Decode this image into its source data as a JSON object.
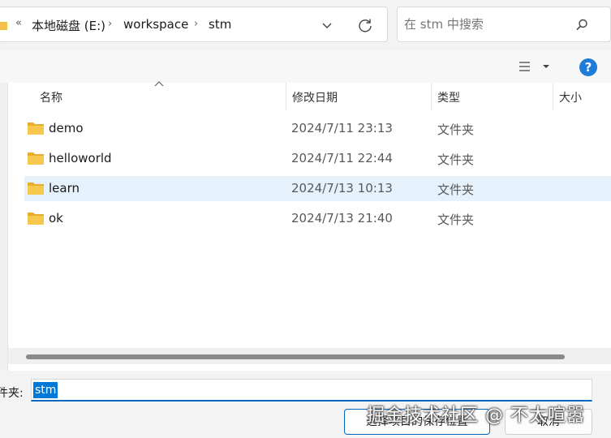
{
  "breadcrumb": {
    "overflow": "«",
    "items": [
      "本地磁盘 (E:)",
      "workspace",
      "stm"
    ],
    "separator": "›"
  },
  "search": {
    "placeholder": "在 stm 中搜索"
  },
  "columns": {
    "name": "名称",
    "date": "修改日期",
    "type": "类型",
    "size": "大小"
  },
  "files": [
    {
      "name": "demo",
      "date": "2024/7/11 23:13",
      "type": "文件夹",
      "icon": "folder-icon"
    },
    {
      "name": "helloworld",
      "date": "2024/7/11 22:44",
      "type": "文件夹",
      "icon": "folder-icon"
    },
    {
      "name": "learn",
      "date": "2024/7/13 10:13",
      "type": "文件夹",
      "icon": "folder-icon",
      "selected": true
    },
    {
      "name": "ok",
      "date": "2024/7/13 21:40",
      "type": "文件夹",
      "icon": "folder-icon"
    }
  ],
  "folder_field": {
    "label": "件夹:",
    "value": "stm"
  },
  "buttons": {
    "select": "选择项目的保存位置",
    "cancel": "取消"
  },
  "help": {
    "glyph": "?"
  },
  "watermark": "掘金技术社区 @ 不太喧嚣",
  "colors": {
    "accent": "#0067c0",
    "selected_row": "#e5f1fb",
    "folder": "#f2c04a",
    "help": "#1f7ad8"
  }
}
